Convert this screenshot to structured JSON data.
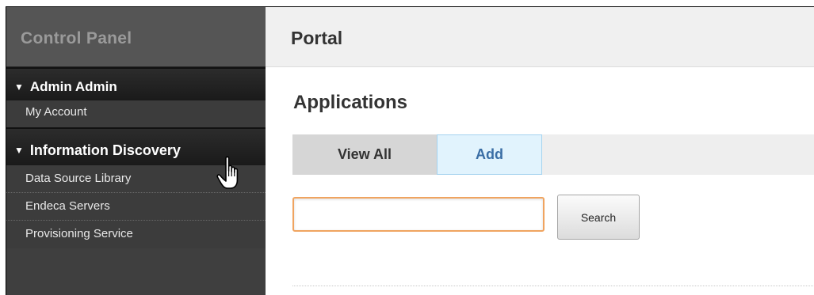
{
  "sidebar": {
    "title": "Control Panel",
    "sections": [
      {
        "label": "Admin Admin",
        "items": [
          "My Account"
        ]
      },
      {
        "label": "Information Discovery",
        "items": [
          "Data Source Library",
          "Endeca Servers",
          "Provisioning Service"
        ]
      }
    ]
  },
  "main": {
    "title": "Portal",
    "heading": "Applications",
    "tabs": [
      {
        "label": "View All",
        "selected": false
      },
      {
        "label": "Add",
        "selected": true
      }
    ],
    "search": {
      "value": "",
      "button_label": "Search"
    }
  },
  "icons": {
    "expanded": "triangle-down",
    "cursor": "hand-pointer"
  },
  "colors": {
    "sidebar_bg": "#3f3f3f",
    "active_tab_bg": "#e1f3fd",
    "active_tab_text": "#3a6ea5",
    "focus_border": "#f0a460"
  }
}
